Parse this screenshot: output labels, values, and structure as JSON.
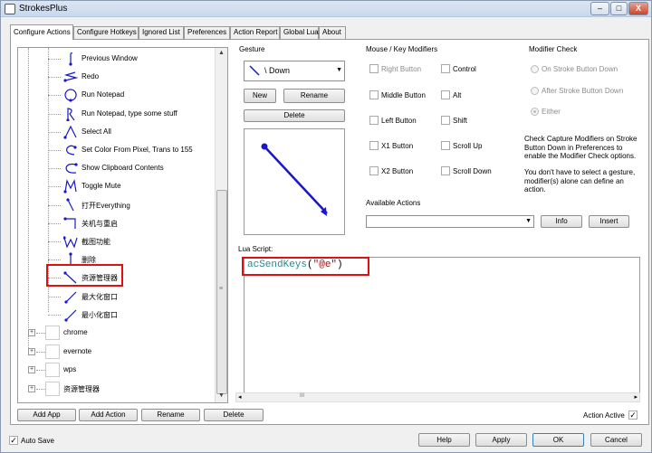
{
  "window": {
    "title": "StrokesPlus",
    "controls": {
      "minimize": "–",
      "maximize": "□",
      "close": "X"
    }
  },
  "tabs": [
    {
      "label": "Configure Actions",
      "active": true
    },
    {
      "label": "Configure Hotkeys"
    },
    {
      "label": "Ignored List"
    },
    {
      "label": "Preferences"
    },
    {
      "label": "Action Report"
    },
    {
      "label": "Global Lua"
    },
    {
      "label": "About"
    }
  ],
  "tree": {
    "items": [
      {
        "label": "Previous Window",
        "icon": "gesture-curve-up-icon"
      },
      {
        "label": "Redo",
        "icon": "gesture-zigzag-icon"
      },
      {
        "label": "Run Notepad",
        "icon": "gesture-circle-icon"
      },
      {
        "label": "Run Notepad, type some stuff",
        "icon": "gesture-r-icon"
      },
      {
        "label": "Select All",
        "icon": "gesture-caret-icon"
      },
      {
        "label": "Set Color From Pixel, Trans to 155",
        "icon": "gesture-c-icon"
      },
      {
        "label": "Show Clipboard Contents",
        "icon": "gesture-c-arc-icon"
      },
      {
        "label": "Toggle Mute",
        "icon": "gesture-m-icon"
      },
      {
        "label": "打开Everything",
        "icon": "gesture-down-icon"
      },
      {
        "label": "关机与重启",
        "icon": "gesture-hook-icon"
      },
      {
        "label": "截图功能",
        "icon": "gesture-w-icon"
      },
      {
        "label": "删除",
        "icon": "gesture-vertical-icon"
      },
      {
        "label": "资源管理器",
        "icon": "gesture-diagonal-down-icon",
        "selected": true
      },
      {
        "label": "最大化窗口",
        "icon": "gesture-diagonal-up-icon"
      },
      {
        "label": "最小化窗口",
        "icon": "gesture-diagonal-up-icon"
      }
    ],
    "groups": [
      {
        "label": "chrome",
        "expander": "+"
      },
      {
        "label": "evernote",
        "expander": "+"
      },
      {
        "label": "wps",
        "expander": "+"
      },
      {
        "label": "资源管理器",
        "expander": "+"
      }
    ],
    "scroll_up": "▲",
    "scroll_down": "▼",
    "scroll_grip": "≡"
  },
  "bottom_buttons": {
    "add_app": "Add App",
    "add_action": "Add Action",
    "rename": "Rename",
    "delete": "Delete"
  },
  "gesture": {
    "group_label": "Gesture",
    "selected": "\\ Down",
    "new": "New",
    "rename": "Rename",
    "delete": "Delete"
  },
  "modifiers": {
    "group_label": "Mouse / Key Modifiers",
    "items": [
      "Right Button",
      "Control",
      "Middle Button",
      "Alt",
      "Left Button",
      "Shift",
      "X1 Button",
      "Scroll Up",
      "X2 Button",
      "Scroll Down"
    ]
  },
  "modifier_check": {
    "group_label": "Modifier Check",
    "options": [
      "On Stroke Button Down",
      "After Stroke Button Down",
      "Either"
    ],
    "selected": "Either",
    "info1": "Check Capture Modifiers on Stroke Button Down in Preferences to enable the Modifier Check options.",
    "info2": "You don't have to select a gesture, modifier(s) alone can define an action."
  },
  "available_actions": {
    "group_label": "Available Actions",
    "value": "",
    "info": "Info",
    "insert": "Insert"
  },
  "lua": {
    "label": "Lua Script:",
    "code_func": "acSendKeys",
    "code_open": "(",
    "code_arg": "\"@e\"",
    "code_close": ")",
    "scroll_glyph": "III",
    "scroll_left": "◂",
    "scroll_right": "▸"
  },
  "action_active": {
    "label": "Action Active",
    "checked": true
  },
  "auto_save": {
    "label": "Auto Save",
    "checked": true
  },
  "footer": {
    "help": "Help",
    "apply": "Apply",
    "ok": "OK",
    "cancel": "Cancel"
  },
  "colors": {
    "stroke": "#1818c8",
    "highlight": "#e01010",
    "code_func": "#2a8a8a",
    "code_string": "#a31515"
  }
}
